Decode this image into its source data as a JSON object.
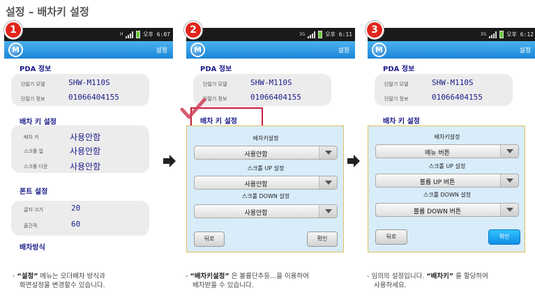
{
  "page": {
    "title": "설정 – 배차키 설정"
  },
  "phones": [
    {
      "step": "1",
      "status": {
        "network": "H",
        "time": "오후 6:07"
      },
      "app": {
        "logo": "M",
        "title": "설정"
      },
      "pda": {
        "section": "PDA 정보",
        "model_label": "단말기 모델",
        "model": "SHW-M110S",
        "info_label": "단말기 정보",
        "phone": "01066404155"
      },
      "dispatch": {
        "section": "배차 키 설정",
        "rows": [
          {
            "label": "배차 키",
            "value": "사용안함"
          },
          {
            "label": "스크롤 업",
            "value": "사용안함"
          },
          {
            "label": "스크롤 다운",
            "value": "사용안함"
          }
        ]
      },
      "font": {
        "section": "폰트 설정",
        "rows": [
          {
            "label": "글자 크기",
            "value": "20"
          },
          {
            "label": "줄간격",
            "value": "60"
          }
        ]
      },
      "method": {
        "section": "배차방식"
      }
    },
    {
      "step": "2",
      "status": {
        "network": "3G",
        "time": "오후 6:11"
      },
      "app": {
        "logo": "M",
        "title": "설정"
      },
      "pda": {
        "section": "PDA 정보",
        "model_label": "단말기 모델",
        "model": "SHW-M110S",
        "info_label": "단말기 정보",
        "phone": "01066404155"
      },
      "dispatch": {
        "section": "배차 키 설정"
      },
      "dialog": {
        "key_label": "배차키설정",
        "key_value": "사용안함",
        "up_label": "스크롤 UP 설정",
        "up_value": "사용안함",
        "down_label": "스크롤 DOWN 설정",
        "down_value": "사용안함",
        "back": "뒤로",
        "ok": "확인"
      }
    },
    {
      "step": "3",
      "status": {
        "network": "3G",
        "time": "오후 6:12"
      },
      "app": {
        "logo": "M",
        "title": "설정"
      },
      "pda": {
        "section": "PDA 정보",
        "model_label": "단말기 모델",
        "model": "SHW-M110S",
        "info_label": "단말기 정보",
        "phone": "01066404155"
      },
      "dispatch": {
        "section": "배차 키 설정"
      },
      "dialog": {
        "key_label": "배차키설정",
        "key_value": "메뉴 버튼",
        "up_label": "스크롤 UP 설정",
        "up_value": "볼륨 UP 버튼",
        "down_label": "스크롤 DOWN 설정",
        "down_value": "볼륨 DOWN 버튼",
        "back": "뒤로",
        "ok": "확인"
      }
    }
  ],
  "captions": [
    {
      "dash": "-",
      "bold": "“설정”",
      "text1": " 메뉴는 오더배차 방식과",
      "text2": "화면설정을 변경할수 있습니다."
    },
    {
      "dash": "-",
      "bold": "“배차키설정”",
      "text1": " 은 볼륨단추등...을 이용하여",
      "text2": "배차받을 수 있습니다."
    },
    {
      "dash": "-",
      "pre": " 임의의 설정입니다.  ",
      "bold": "“배차키”",
      "text1": "  를 할당하여",
      "text2": "사용하세요."
    }
  ],
  "colors": {
    "badge": "#e1251b",
    "appbar": "#1c86d6",
    "highlight": "#c61d3c",
    "checkmark": "#d0405a"
  }
}
